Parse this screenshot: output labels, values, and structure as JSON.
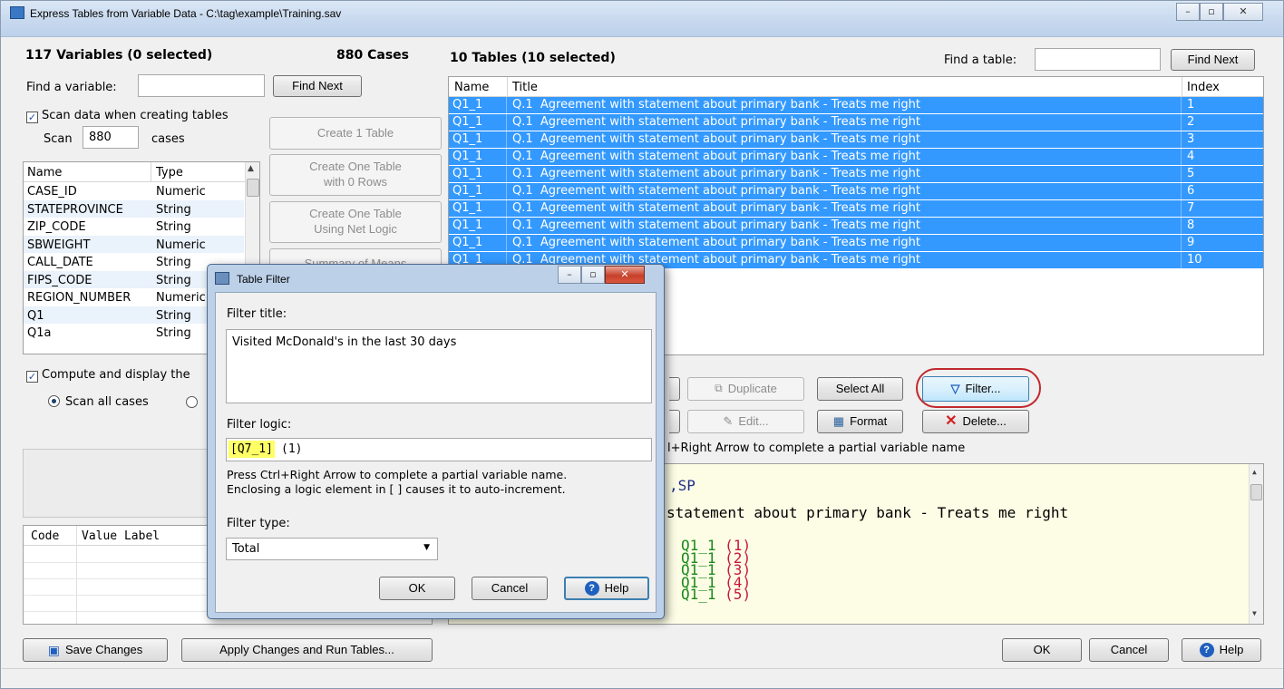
{
  "window": {
    "title": "Express Tables from Variable Data - C:\\tag\\example\\Training.sav"
  },
  "left": {
    "var_count": "117 Variables  (0 selected)",
    "cases": "880 Cases",
    "find_var_label": "Find a variable:",
    "find_next": "Find Next",
    "scan_check": "Scan data when creating tables",
    "scan_label": "Scan",
    "scan_value": "880",
    "cases_label": "cases",
    "columns": {
      "name": "Name",
      "type": "Type"
    },
    "variables": [
      {
        "name": "CASE_ID",
        "type": "Numeric"
      },
      {
        "name": "STATEPROVINCE",
        "type": "String"
      },
      {
        "name": "ZIP_CODE",
        "type": "String"
      },
      {
        "name": "SBWEIGHT",
        "type": "Numeric"
      },
      {
        "name": "CALL_DATE",
        "type": "String"
      },
      {
        "name": "FIPS_CODE",
        "type": "String"
      },
      {
        "name": "REGION_NUMBER",
        "type": "Numeric"
      },
      {
        "name": "Q1",
        "type": "String"
      },
      {
        "name": "Q1a",
        "type": "String"
      }
    ],
    "compute_check": "Compute and display the",
    "scan_all": "Scan all cases",
    "code_col": "Code",
    "value_label_col": "Value Label"
  },
  "mid_buttons": {
    "create_1": "Create 1 Table",
    "create_one_rows": "Create One Table\nwith 0 Rows",
    "create_net": "Create One Table\nUsing Net Logic",
    "summary": "Summary of Means"
  },
  "tables": {
    "count": "10 Tables  (10 selected)",
    "find_label": "Find a table:",
    "find_next": "Find Next",
    "columns": {
      "name": "Name",
      "title": "Title",
      "index": "Index"
    },
    "rows": [
      {
        "name": "Q1_1",
        "title": "Q.1  Agreement with statement about primary bank - Treats me right",
        "index": "1"
      },
      {
        "name": "Q1_1",
        "title": "Q.1  Agreement with statement about primary bank - Treats me right",
        "index": "2"
      },
      {
        "name": "Q1_1",
        "title": "Q.1  Agreement with statement about primary bank - Treats me right",
        "index": "3"
      },
      {
        "name": "Q1_1",
        "title": "Q.1  Agreement with statement about primary bank - Treats me right",
        "index": "4"
      },
      {
        "name": "Q1_1",
        "title": "Q.1  Agreement with statement about primary bank - Treats me right",
        "index": "5"
      },
      {
        "name": "Q1_1",
        "title": "Q.1  Agreement with statement about primary bank - Treats me right",
        "index": "6"
      },
      {
        "name": "Q1_1",
        "title": "Q.1  Agreement with statement about primary bank - Treats me right",
        "index": "7"
      },
      {
        "name": "Q1_1",
        "title": "Q.1  Agreement with statement about primary bank - Treats me right",
        "index": "8"
      },
      {
        "name": "Q1_1",
        "title": "Q.1  Agreement with statement about primary bank - Treats me right",
        "index": "9"
      },
      {
        "name": "Q1_1",
        "title": "Q.1  Agreement with statement about primary bank - Treats me right",
        "index": "10"
      }
    ],
    "visible_tails": [
      "tatement about primary bank - Treats me right",
      "tatement about primary bank - Treats me right"
    ],
    "partial_mid": "Agreement with"
  },
  "actions": {
    "duplicate": "Duplicate",
    "select_all": "Select All",
    "filter": "Filter...",
    "edit": "Edit...",
    "format": "Format",
    "delete": "Delete...",
    "hint": "l+Right Arrow to complete a partial variable name"
  },
  "editor": {
    "line1": ",SP",
    "line2": "statement about primary bank - Treats me right",
    "logic": [
      {
        "var": "Q1_1",
        "val": "(1)"
      },
      {
        "var": "Q1_1",
        "val": "(2)"
      },
      {
        "var": "Q1_1",
        "val": "(3)"
      },
      {
        "var": "Q1_1",
        "val": "(4)"
      },
      {
        "var": "Q1_1",
        "val": "(5)"
      }
    ]
  },
  "dialog": {
    "title": "Table Filter",
    "filter_title_label": "Filter title:",
    "filter_title_value": "Visited McDonald's in the last 30 days",
    "filter_logic_label": "Filter logic:",
    "logic_var": "[Q7_1]",
    "logic_val": " (1)",
    "hint1": "Press Ctrl+Right Arrow to complete a partial variable name.",
    "hint2": "Enclosing a logic element in [ ] causes it to auto-increment.",
    "filter_type_label": "Filter type:",
    "filter_type_value": "Total",
    "ok": "OK",
    "cancel": "Cancel",
    "help": "Help"
  },
  "bottom": {
    "save": "Save Changes",
    "apply": "Apply Changes and Run Tables...",
    "ok": "OK",
    "cancel": "Cancel",
    "help": "Help"
  },
  "colors": {
    "selection": "#3399ff",
    "highlight": "#ffff66",
    "accent_ring": "#c0282d"
  }
}
